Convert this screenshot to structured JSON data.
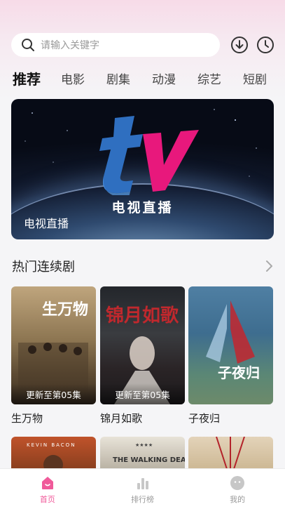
{
  "search": {
    "placeholder": "请输入关键字"
  },
  "tabs": [
    {
      "label": "推荐",
      "active": true
    },
    {
      "label": "电影"
    },
    {
      "label": "剧集"
    },
    {
      "label": "动漫"
    },
    {
      "label": "综艺"
    },
    {
      "label": "短剧"
    }
  ],
  "banner": {
    "logo_text": "电视直播",
    "caption": "电视直播"
  },
  "section": {
    "title": "热门连续剧"
  },
  "cards": [
    {
      "name": "生万物",
      "episode": "更新至第05集",
      "poster_text": "生万物"
    },
    {
      "name": "锦月如歌",
      "episode": "更新至第05集",
      "poster_text": "锦月如歌"
    },
    {
      "name": "子夜归",
      "episode": "",
      "poster_text": "子夜归"
    }
  ],
  "row2": [
    {
      "poster_text": "KEVIN BACON"
    },
    {
      "poster_text": "THE WALKING DEAD"
    },
    {
      "poster_text": ""
    }
  ],
  "bottom_nav": [
    {
      "label": "首页",
      "active": true,
      "icon": "home-icon"
    },
    {
      "label": "排行榜",
      "icon": "chart-icon"
    },
    {
      "label": "我的",
      "icon": "profile-icon"
    }
  ],
  "colors": {
    "accent": "#f05a9a",
    "tv_blue": "#2f6fc0",
    "tv_pink": "#e8187c"
  }
}
